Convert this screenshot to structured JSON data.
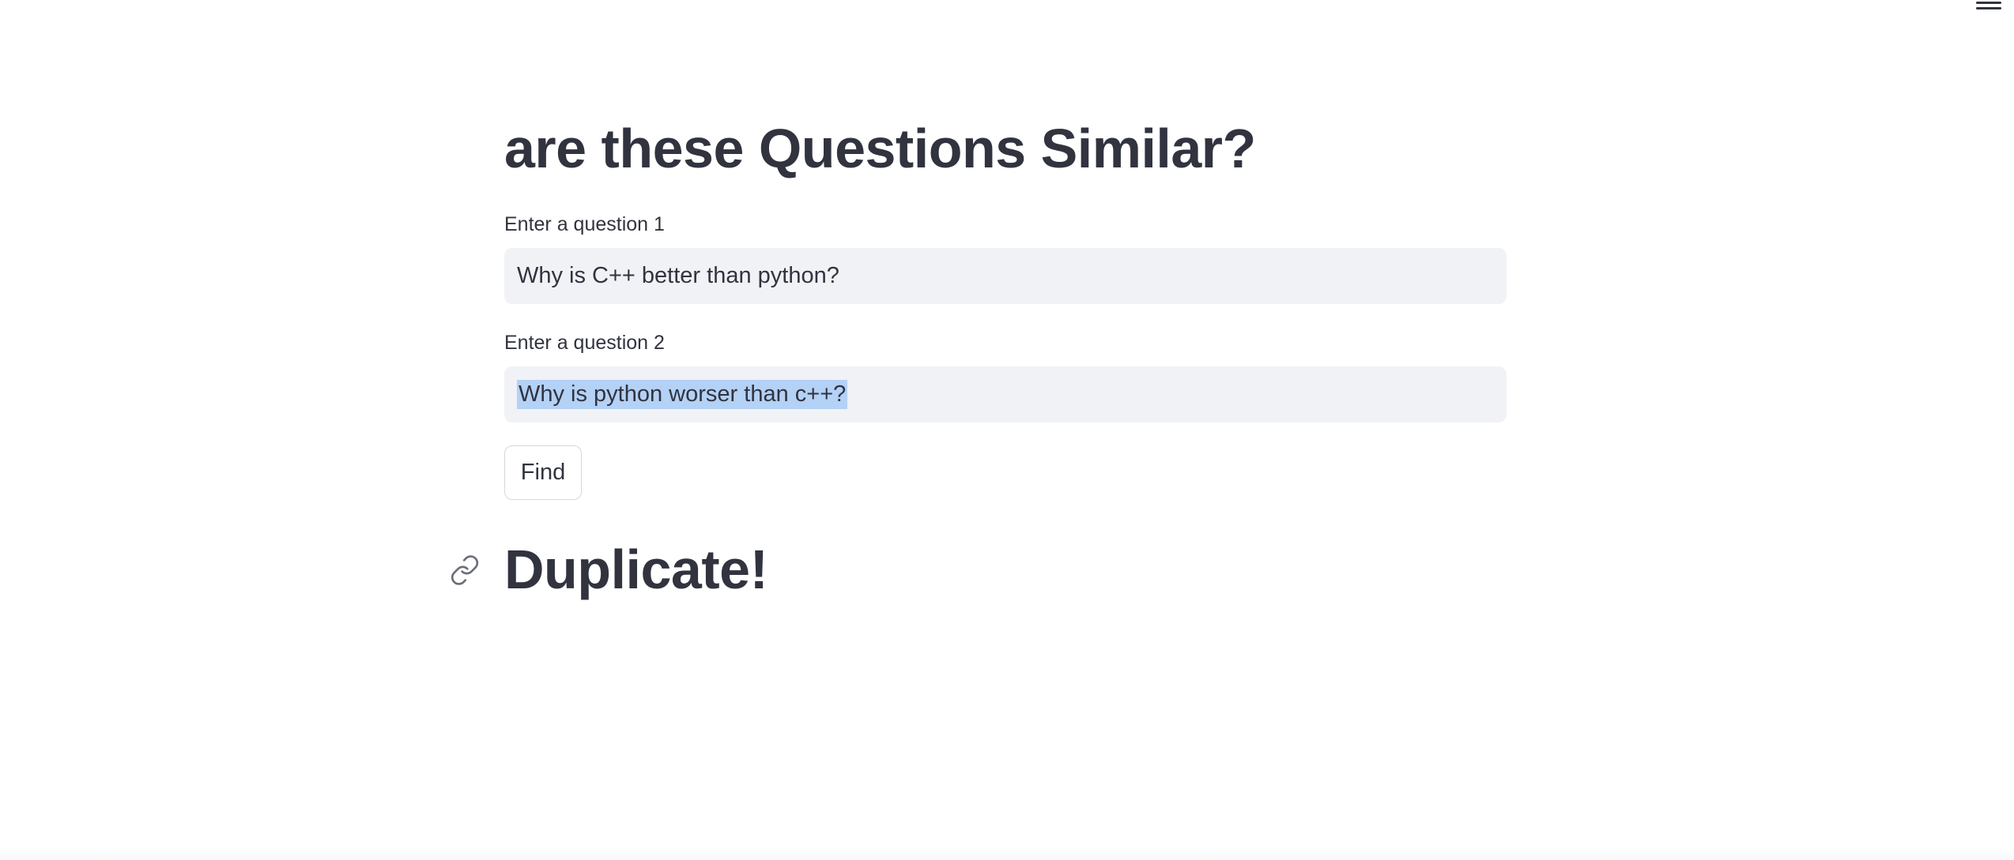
{
  "header": {
    "menu_icon": "hamburger-menu-icon"
  },
  "main": {
    "title": "are these Questions Similar?",
    "question1": {
      "label": "Enter a question 1",
      "value": "Why is C++ better than python?"
    },
    "question2": {
      "label": "Enter a question 2",
      "value": "Why is python worser than c++?"
    },
    "find_button": "Find",
    "result": {
      "anchor_icon": "link-icon",
      "text": "Duplicate!"
    }
  },
  "colors": {
    "text": "#31333f",
    "input_background": "#f0f2f6",
    "selection": "#b4d1f6",
    "button_border": "#d6d7dc"
  }
}
